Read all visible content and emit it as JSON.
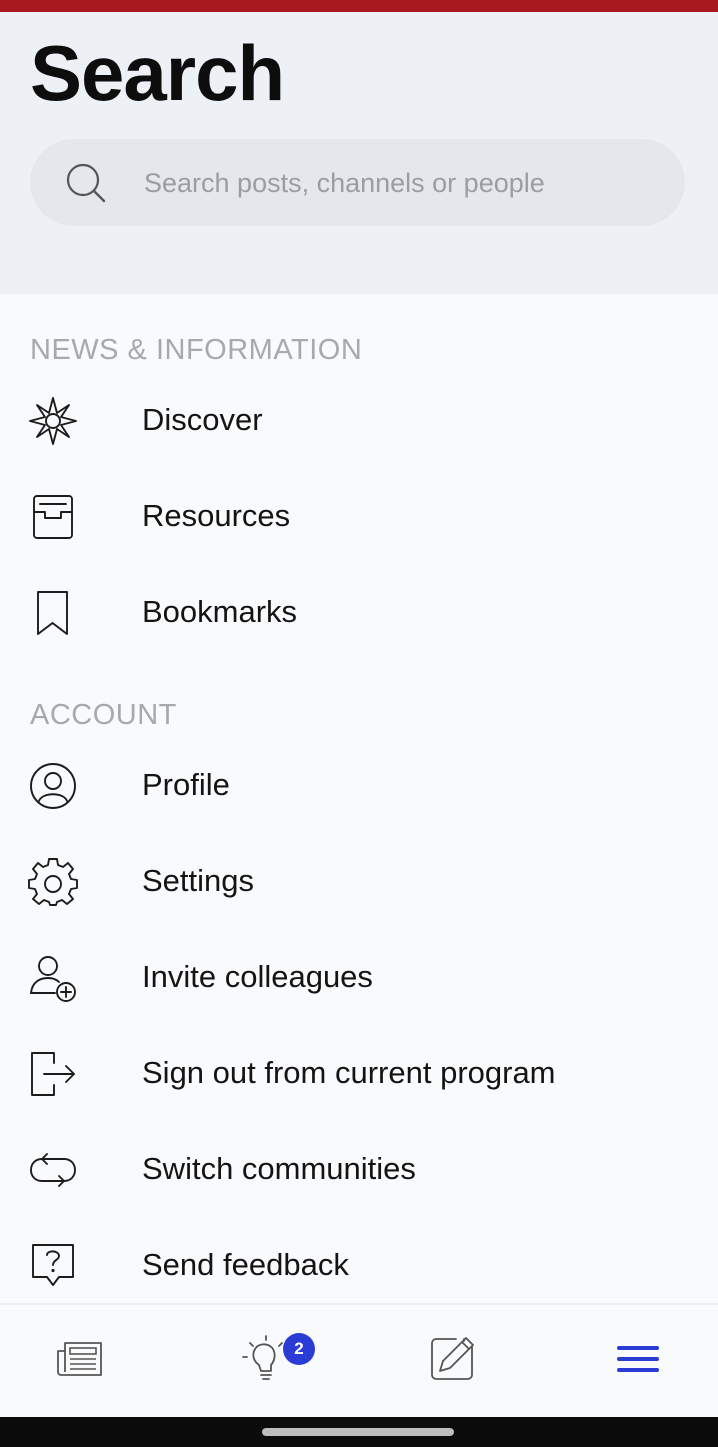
{
  "header": {
    "title": "Search",
    "search": {
      "placeholder": "Search posts, channels or people",
      "value": ""
    }
  },
  "sections": {
    "news": {
      "title": "NEWS & INFORMATION",
      "items": [
        {
          "label": "Discover",
          "icon": "compass-star-icon"
        },
        {
          "label": "Resources",
          "icon": "inbox-tray-icon"
        },
        {
          "label": "Bookmarks",
          "icon": "bookmark-icon"
        }
      ]
    },
    "account": {
      "title": "ACCOUNT",
      "items": [
        {
          "label": "Profile",
          "icon": "user-circle-icon"
        },
        {
          "label": "Settings",
          "icon": "gear-icon"
        },
        {
          "label": "Invite colleagues",
          "icon": "user-add-icon"
        },
        {
          "label": "Sign out from current program",
          "icon": "sign-out-icon"
        },
        {
          "label": "Switch communities",
          "icon": "switch-arrows-icon"
        },
        {
          "label": "Send feedback",
          "icon": "feedback-question-icon"
        }
      ]
    }
  },
  "bottom_nav": {
    "items": [
      {
        "icon": "newspaper-icon",
        "active": false
      },
      {
        "icon": "lightbulb-icon",
        "active": false,
        "badge": "2"
      },
      {
        "icon": "compose-pencil-icon",
        "active": false
      },
      {
        "icon": "hamburger-menu-icon",
        "active": true
      }
    ],
    "active_color": "#2b3bd6"
  },
  "colors": {
    "status_strip": "#a8191f",
    "header_bg": "#edf0f5",
    "badge": "#2b3bd6"
  }
}
